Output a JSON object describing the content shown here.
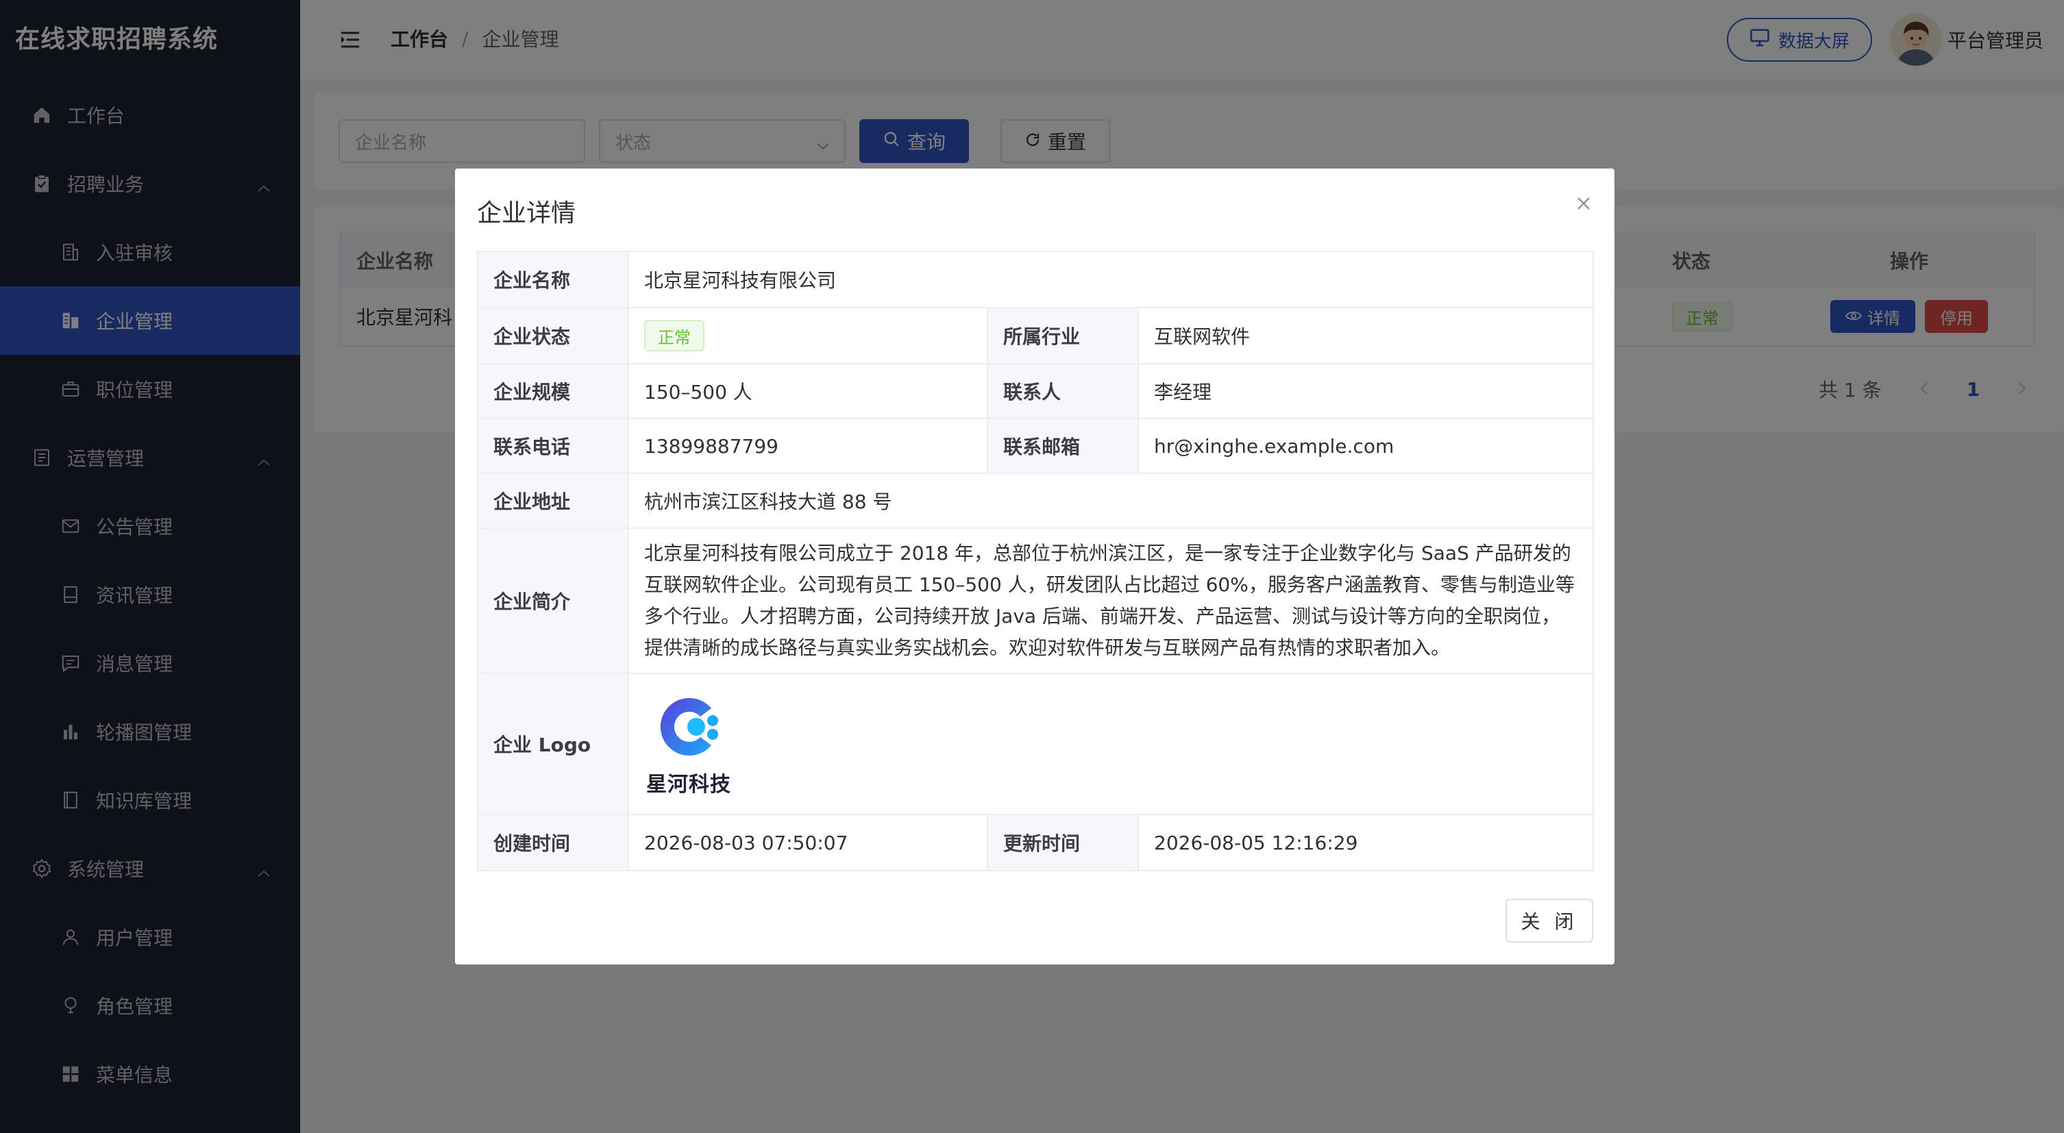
{
  "app": {
    "brand": "在线求职招聘系统"
  },
  "sidebar": {
    "items": [
      {
        "label": "工作台",
        "icon": "home-icon"
      },
      {
        "label": "招聘业务",
        "icon": "clipboard-icon"
      },
      {
        "label": "入驻审核",
        "icon": "building-icon"
      },
      {
        "label": "企业管理",
        "icon": "company-icon",
        "active": true
      },
      {
        "label": "职位管理",
        "icon": "briefcase-icon"
      },
      {
        "label": "运营管理",
        "icon": "document-icon"
      },
      {
        "label": "公告管理",
        "icon": "mail-icon"
      },
      {
        "label": "资讯管理",
        "icon": "news-icon"
      },
      {
        "label": "消息管理",
        "icon": "chat-icon"
      },
      {
        "label": "轮播图管理",
        "icon": "bar-chart-icon"
      },
      {
        "label": "知识库管理",
        "icon": "book-icon"
      },
      {
        "label": "系统管理",
        "icon": "gear-icon"
      },
      {
        "label": "用户管理",
        "icon": "user-icon"
      },
      {
        "label": "角色管理",
        "icon": "bulb-icon"
      },
      {
        "label": "菜单信息",
        "icon": "grid-icon"
      }
    ]
  },
  "header": {
    "breadcrumb": [
      "工作台",
      "企业管理"
    ],
    "separator": "/",
    "screen_button": "数据大屏",
    "username": "平台管理员"
  },
  "search": {
    "name_placeholder": "企业名称",
    "status_placeholder": "状态",
    "query_label": "查询",
    "reset_label": "重置"
  },
  "table": {
    "columns": [
      "企业名称",
      "状态",
      "操作"
    ],
    "rows": [
      {
        "name": "北京星河科",
        "status": "正常",
        "detail": "详情",
        "disable": "停用"
      }
    ],
    "total": "共 1 条",
    "page": "1"
  },
  "dialog": {
    "title": "企业详情",
    "fields": {
      "name_label": "企业名称",
      "name": "北京星河科技有限公司",
      "status_label": "企业状态",
      "status": "正常",
      "industry_label": "所属行业",
      "industry": "互联网软件",
      "scale_label": "企业规模",
      "scale": "150–500 人",
      "contact_label": "联系人",
      "contact": "李经理",
      "phone_label": "联系电话",
      "phone": "13899887799",
      "email_label": "联系邮箱",
      "email": "hr@xinghe.example.com",
      "address_label": "企业地址",
      "address": "杭州市滨江区科技大道 88 号",
      "intro_label": "企业简介",
      "intro": "北京星河科技有限公司成立于 2018 年，总部位于杭州滨江区，是一家专注于企业数字化与 SaaS 产品研发的互联网软件企业。公司现有员工 150–500 人，研发团队占比超过 60%，服务客户涵盖教育、零售与制造业等多个行业。人才招聘方面，公司持续开放 Java 后端、前端开发、产品运营、测试与设计等方向的全职岗位，提供清晰的成长路径与真实业务实战机会。欢迎对软件研发与互联网产品有热情的求职者加入。",
      "logo_label": "企业 Logo",
      "logo_text": "星河科技",
      "created_label": "创建时间",
      "created": "2026-08-03 07:50:07",
      "updated_label": "更新时间",
      "updated": "2026-08-05 12:16:29"
    },
    "close_button": "关 闭"
  },
  "colors": {
    "primary": "#2f57c4",
    "sidebar_bg": "#1f2230",
    "success": "#67c23a",
    "danger": "#e04a4a"
  }
}
